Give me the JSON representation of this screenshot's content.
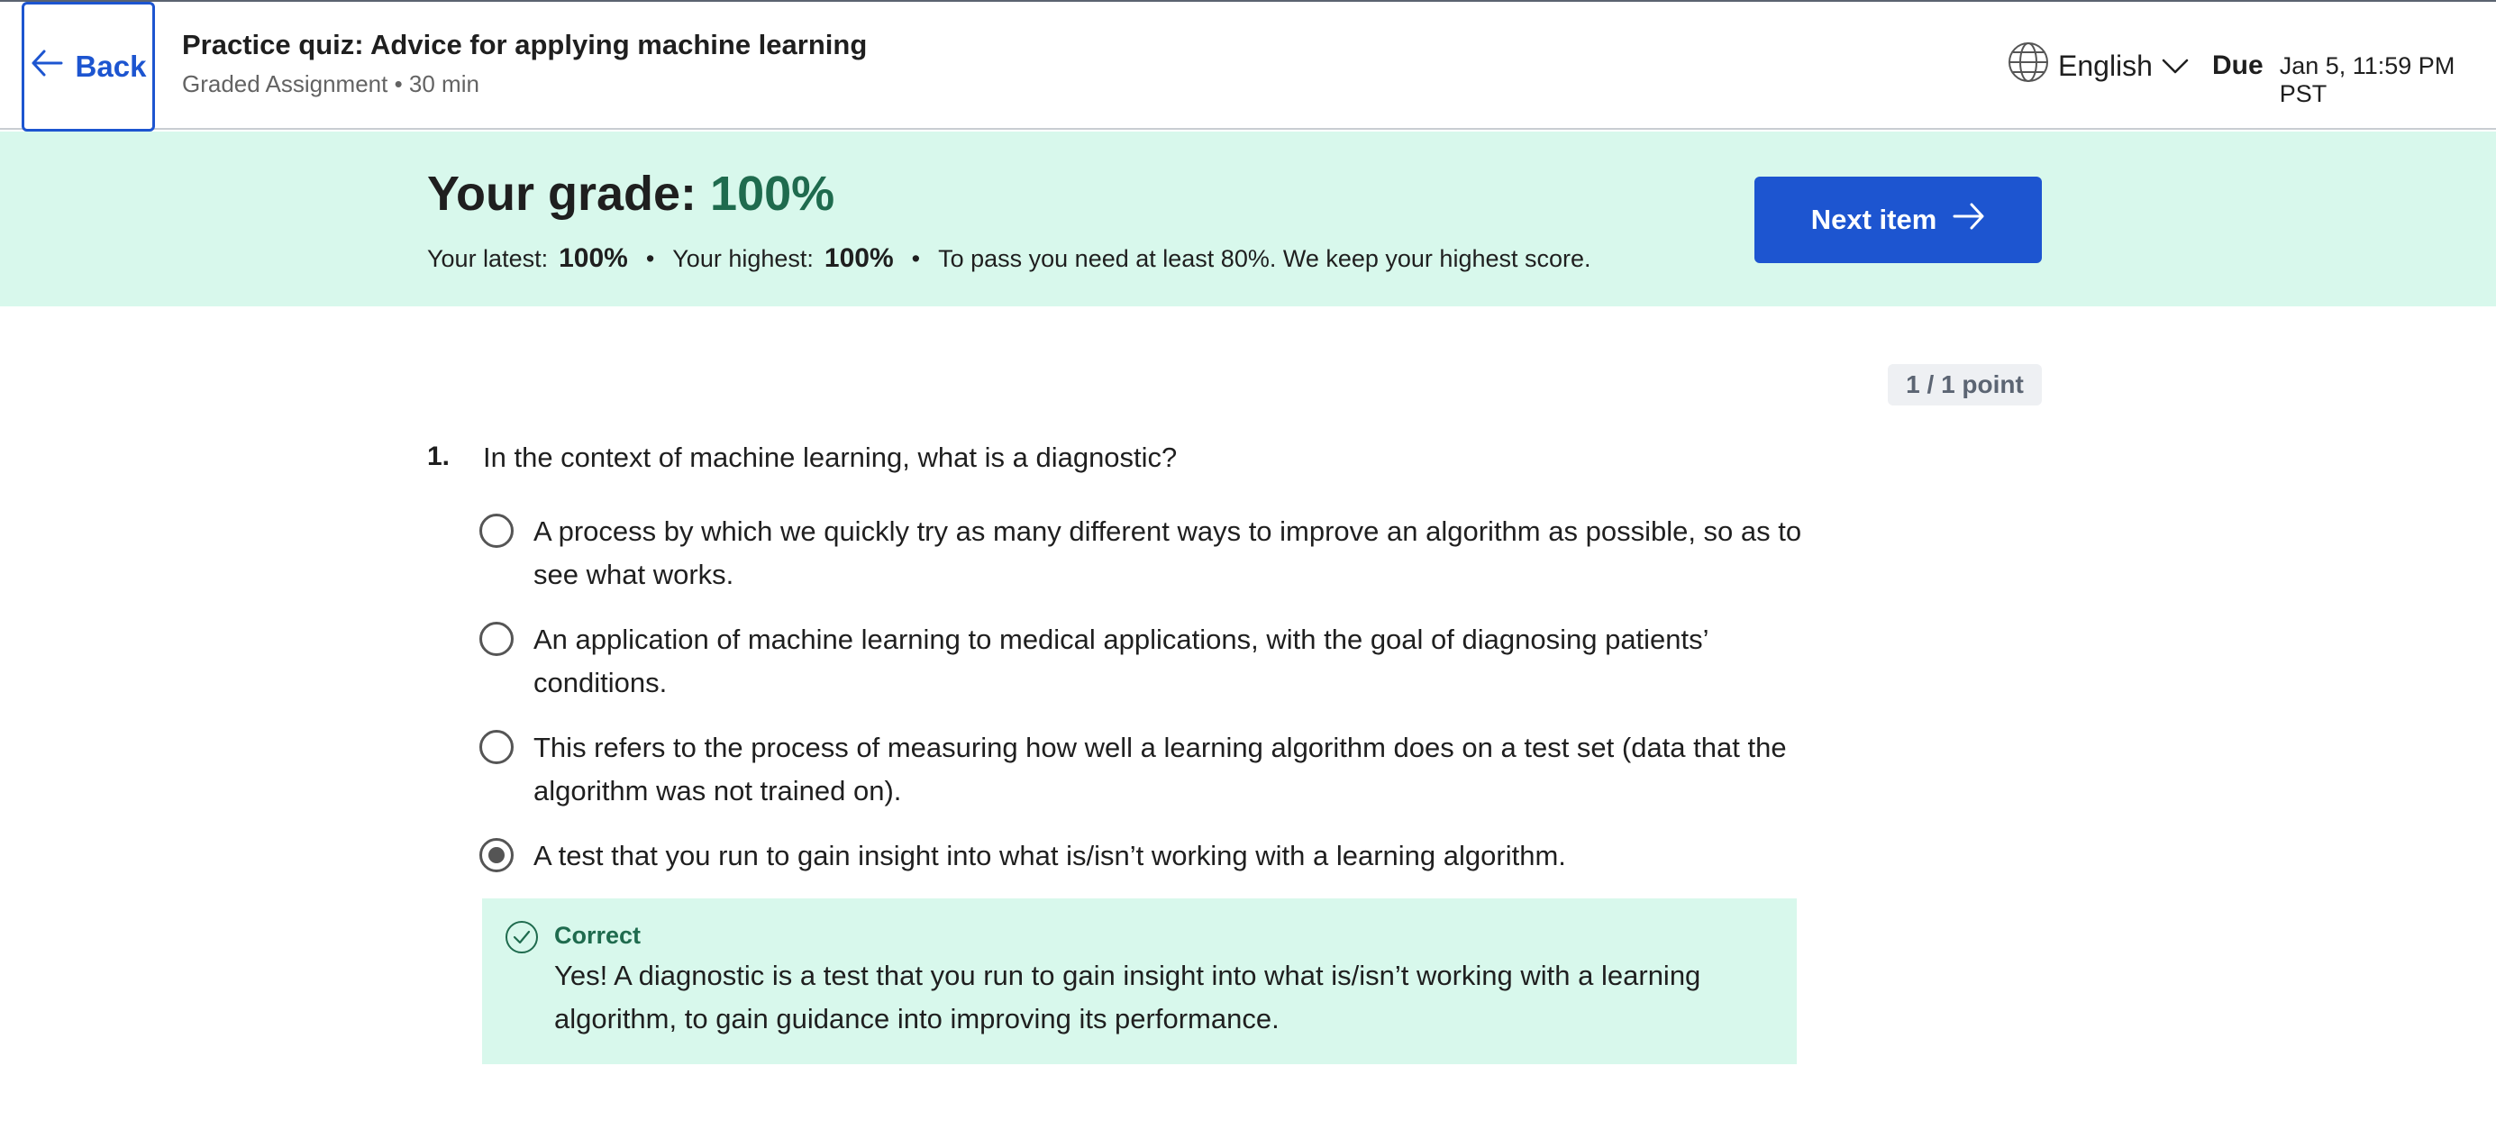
{
  "header": {
    "back_label": "Back",
    "quiz_title": "Practice quiz: Advice for applying machine learning",
    "quiz_subtitle": "Graded Assignment • 30 min",
    "language": "English",
    "due_label": "Due",
    "due_value": "Jan 5, 11:59 PM PST"
  },
  "grade": {
    "title_prefix": "Your grade: ",
    "value": "100%",
    "latest_label": "Your latest:",
    "latest_value": "100%",
    "highest_label": "Your highest:",
    "highest_value": "100%",
    "pass_text": "To pass you need at least 80%. We keep your highest score.",
    "separator": "•",
    "next_label": "Next item"
  },
  "question": {
    "points": "1 / 1 point",
    "number": "1.",
    "text": "In the context of machine learning, what is a diagnostic?",
    "options": [
      {
        "text": "A process by which we quickly try as many different ways to improve an algorithm as possible, so as to see what works.",
        "selected": false
      },
      {
        "text": "An application of machine learning to medical applications, with the goal of diagnosing patients’ conditions.",
        "selected": false
      },
      {
        "text": "This refers to the process of measuring how well a learning algorithm does on a test set (data that the algorithm was not trained on).",
        "selected": false
      },
      {
        "text": "A test that you run to gain insight into what is/isn’t working with a learning algorithm.",
        "selected": true
      }
    ],
    "feedback": {
      "status": "Correct",
      "text": "Yes! A diagnostic is a test that you run to gain insight into what is/isn’t working with a learning algorithm, to gain guidance into improving its performance."
    }
  },
  "colors": {
    "accent": "#1d55d0",
    "success_bg": "#d8f8ec",
    "success_text": "#1f6b4e"
  },
  "icons": {
    "back": "arrow-left-icon",
    "language": "globe-icon",
    "dropdown": "chevron-down-icon",
    "next": "arrow-right-icon",
    "feedback": "check-circle-icon"
  }
}
